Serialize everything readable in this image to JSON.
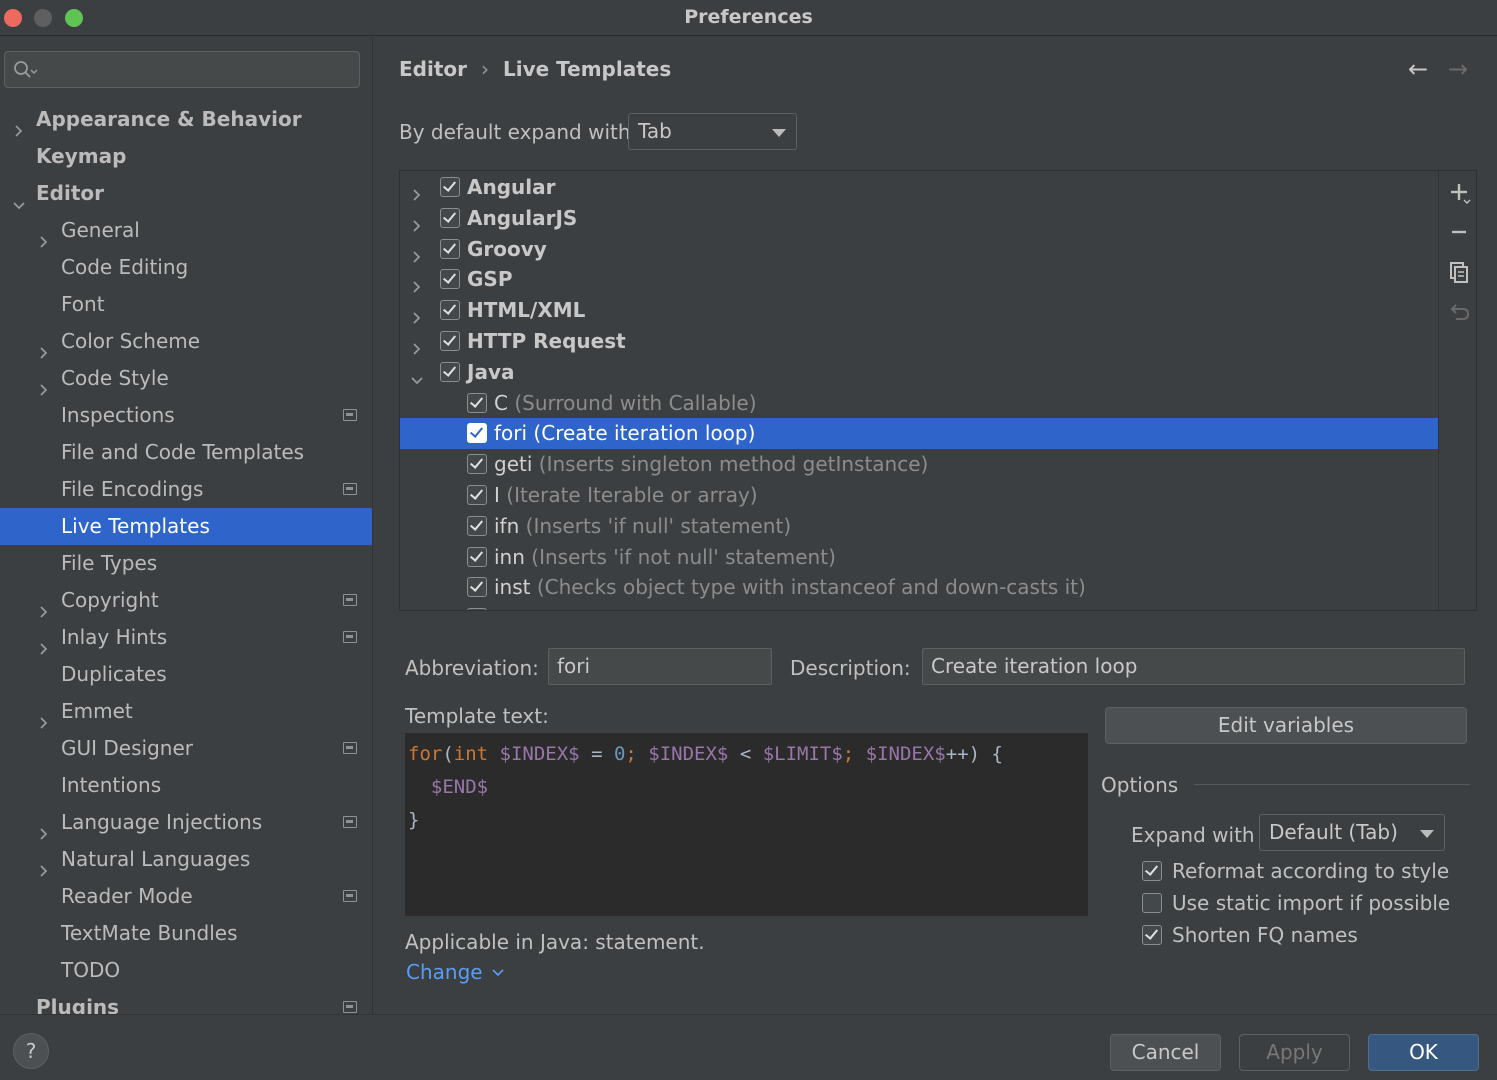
{
  "window": {
    "title": "Preferences"
  },
  "search": {
    "placeholder": ""
  },
  "sidebar": {
    "items": [
      {
        "label": "Appearance & Behavior",
        "level": 0,
        "expand": "collapsed",
        "bold": true
      },
      {
        "label": "Keymap",
        "level": 0,
        "expand": "none",
        "bold": true
      },
      {
        "label": "Editor",
        "level": 0,
        "expand": "expanded",
        "bold": true
      },
      {
        "label": "General",
        "level": 1,
        "expand": "collapsed"
      },
      {
        "label": "Code Editing",
        "level": 1,
        "expand": "none"
      },
      {
        "label": "Font",
        "level": 1,
        "expand": "none"
      },
      {
        "label": "Color Scheme",
        "level": 1,
        "expand": "collapsed"
      },
      {
        "label": "Code Style",
        "level": 1,
        "expand": "collapsed"
      },
      {
        "label": "Inspections",
        "level": 1,
        "expand": "none",
        "project": true
      },
      {
        "label": "File and Code Templates",
        "level": 1,
        "expand": "none"
      },
      {
        "label": "File Encodings",
        "level": 1,
        "expand": "none",
        "project": true
      },
      {
        "label": "Live Templates",
        "level": 1,
        "expand": "none",
        "selected": true
      },
      {
        "label": "File Types",
        "level": 1,
        "expand": "none"
      },
      {
        "label": "Copyright",
        "level": 1,
        "expand": "collapsed",
        "project": true
      },
      {
        "label": "Inlay Hints",
        "level": 1,
        "expand": "collapsed",
        "project": true
      },
      {
        "label": "Duplicates",
        "level": 1,
        "expand": "none"
      },
      {
        "label": "Emmet",
        "level": 1,
        "expand": "collapsed"
      },
      {
        "label": "GUI Designer",
        "level": 1,
        "expand": "none",
        "project": true
      },
      {
        "label": "Intentions",
        "level": 1,
        "expand": "none"
      },
      {
        "label": "Language Injections",
        "level": 1,
        "expand": "collapsed",
        "project": true
      },
      {
        "label": "Natural Languages",
        "level": 1,
        "expand": "collapsed"
      },
      {
        "label": "Reader Mode",
        "level": 1,
        "expand": "none",
        "project": true
      },
      {
        "label": "TextMate Bundles",
        "level": 1,
        "expand": "none"
      },
      {
        "label": "TODO",
        "level": 1,
        "expand": "none"
      },
      {
        "label": "Plugins",
        "level": 0,
        "expand": "none",
        "bold": true,
        "project": true
      }
    ]
  },
  "breadcrumb": {
    "parent": "Editor",
    "current": "Live Templates",
    "separator": "›"
  },
  "expand_default": {
    "label": "By default expand with",
    "value": "Tab"
  },
  "template_tree": {
    "groups": [
      {
        "name": "Angular",
        "checked": true,
        "expanded": false
      },
      {
        "name": "AngularJS",
        "checked": true,
        "expanded": false
      },
      {
        "name": "Groovy",
        "checked": true,
        "expanded": false
      },
      {
        "name": "GSP",
        "checked": true,
        "expanded": false
      },
      {
        "name": "HTML/XML",
        "checked": true,
        "expanded": false
      },
      {
        "name": "HTTP Request",
        "checked": true,
        "expanded": false
      },
      {
        "name": "Java",
        "checked": true,
        "expanded": true
      }
    ],
    "templates": [
      {
        "abbr": "C",
        "desc": "(Surround with Callable)",
        "checked": true
      },
      {
        "abbr": "fori",
        "desc": "(Create iteration loop)",
        "checked": true,
        "selected": true
      },
      {
        "abbr": "geti",
        "desc": "(Inserts singleton method getInstance)",
        "checked": true
      },
      {
        "abbr": "I",
        "desc": "(Iterate Iterable or array)",
        "checked": true
      },
      {
        "abbr": "ifn",
        "desc": "(Inserts 'if null' statement)",
        "checked": true
      },
      {
        "abbr": "inn",
        "desc": "(Inserts 'if not null' statement)",
        "checked": true
      },
      {
        "abbr": "inst",
        "desc": "(Checks object type with instanceof and down-casts it)",
        "checked": true
      }
    ],
    "toolbar": [
      "add-icon",
      "remove-icon",
      "copy-icon",
      "restore-icon"
    ]
  },
  "form": {
    "abbreviation_label": "Abbreviation:",
    "abbreviation_value": "fori",
    "description_label": "Description:",
    "description_value": "Create iteration loop",
    "template_text_label": "Template text:",
    "code": {
      "l1_for": "for",
      "l1_paren": "(",
      "l1_int": "int",
      "l1_index": " $INDEX$",
      "l1_eq": " = ",
      "l1_zero": "0",
      "l1_semi1": ";",
      "l1_index2": " $INDEX$",
      "l1_lt": " < ",
      "l1_limit": "$LIMIT$",
      "l1_semi2": ";",
      "l1_index3": " $INDEX$",
      "l1_tail": "++) {",
      "l2_end": "  $END$",
      "l3_close": "}"
    },
    "edit_variables": "Edit variables",
    "options_title": "Options",
    "expand_with_label": "Expand with",
    "expand_with_value": "Default (Tab)",
    "options": [
      {
        "label": "Reformat according to style",
        "checked": true
      },
      {
        "label": "Use static import if possible",
        "checked": false
      },
      {
        "label": "Shorten FQ names",
        "checked": true
      }
    ],
    "applicable": "Applicable in Java: statement.",
    "change_link": "Change"
  },
  "footer": {
    "help": "?",
    "cancel": "Cancel",
    "apply": "Apply",
    "ok": "OK"
  },
  "colors": {
    "accent": "#2f65ca",
    "background": "#3c3f41",
    "link": "#589df6",
    "editor_bg": "#2b2b2b"
  }
}
